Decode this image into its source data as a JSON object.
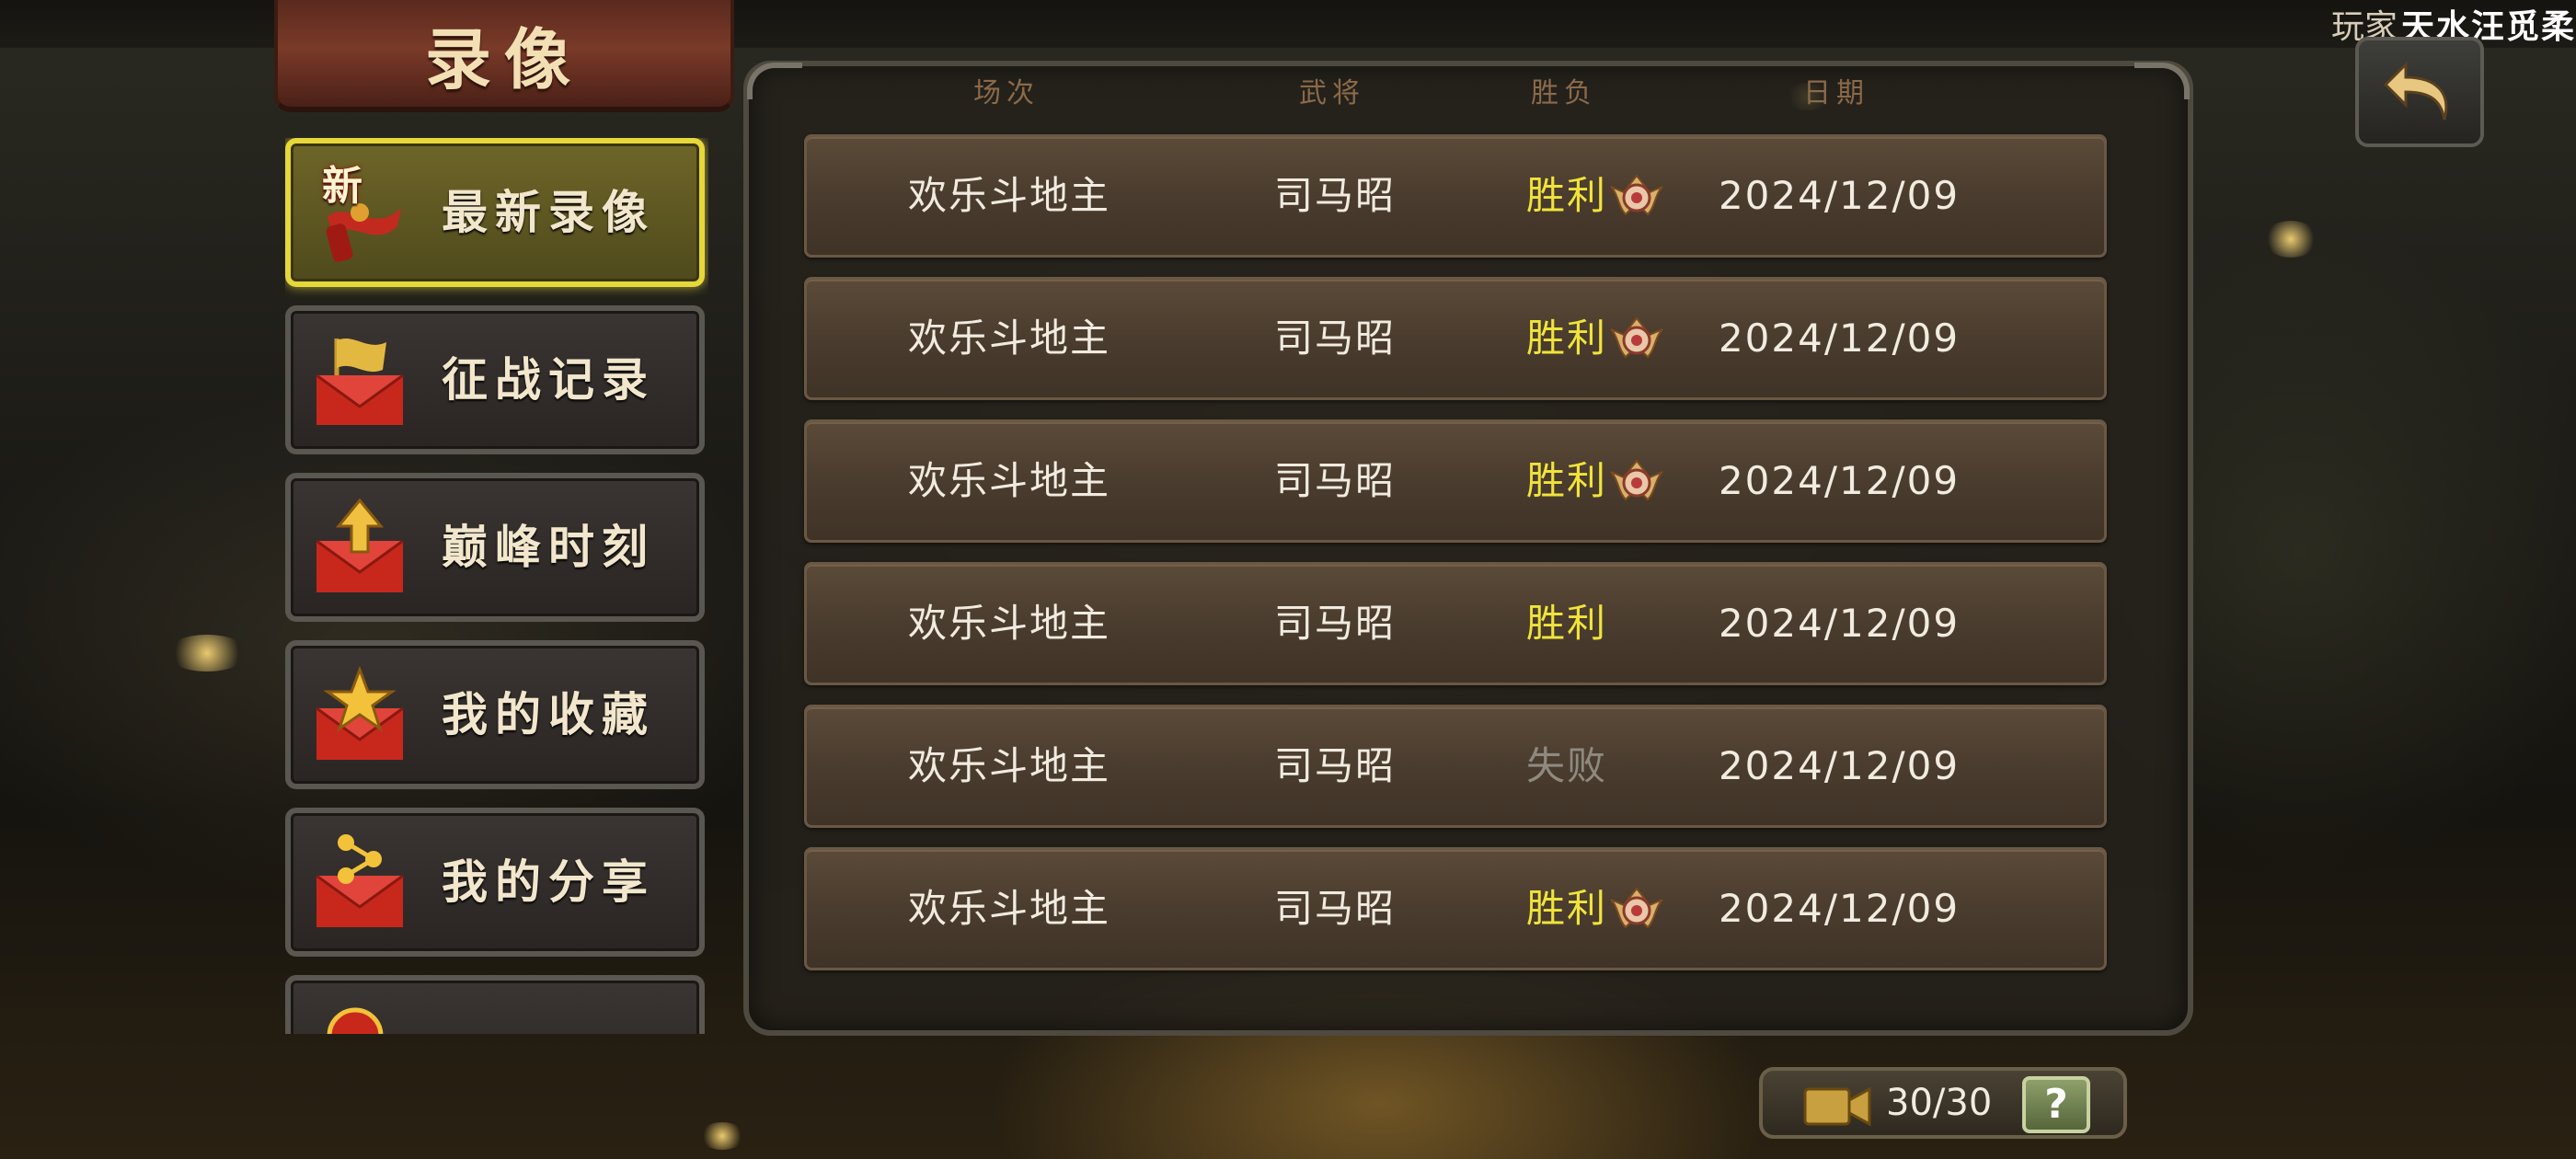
{
  "header": {
    "title": "录像",
    "player_label": "玩家",
    "player_name": "天水汪觅柔"
  },
  "sidebar": {
    "items": [
      {
        "label": "最新录像",
        "badge": "新",
        "icon": "new-ribbon-icon",
        "active": true
      },
      {
        "label": "征战记录",
        "icon": "flag-envelope-icon",
        "active": false
      },
      {
        "label": "巅峰时刻",
        "icon": "arrow-up-envelope-icon",
        "active": false
      },
      {
        "label": "我的收藏",
        "icon": "star-envelope-icon",
        "active": false
      },
      {
        "label": "我的分享",
        "icon": "share-envelope-icon",
        "active": false
      },
      {
        "label": "",
        "icon": "partial-item-icon",
        "active": false
      }
    ]
  },
  "table": {
    "headers": [
      "场次",
      "武将",
      "胜负",
      "日期"
    ],
    "rows": [
      {
        "mode": "欢乐斗地主",
        "general": "司马昭",
        "result": "胜利",
        "medal": true,
        "date": "2024/12/09"
      },
      {
        "mode": "欢乐斗地主",
        "general": "司马昭",
        "result": "胜利",
        "medal": true,
        "date": "2024/12/09"
      },
      {
        "mode": "欢乐斗地主",
        "general": "司马昭",
        "result": "胜利",
        "medal": true,
        "date": "2024/12/09"
      },
      {
        "mode": "欢乐斗地主",
        "general": "司马昭",
        "result": "胜利",
        "medal": false,
        "date": "2024/12/09"
      },
      {
        "mode": "欢乐斗地主",
        "general": "司马昭",
        "result": "失败",
        "medal": false,
        "date": "2024/12/09"
      },
      {
        "mode": "欢乐斗地主",
        "general": "司马昭",
        "result": "胜利",
        "medal": true,
        "date": "2024/12/09"
      }
    ]
  },
  "footer": {
    "count": "30/30",
    "help": "?",
    "icon": "video-camera-icon"
  },
  "colors": {
    "win": "#f0e43a",
    "lose": "#8e8a80",
    "active_border": "#e6d73a"
  }
}
